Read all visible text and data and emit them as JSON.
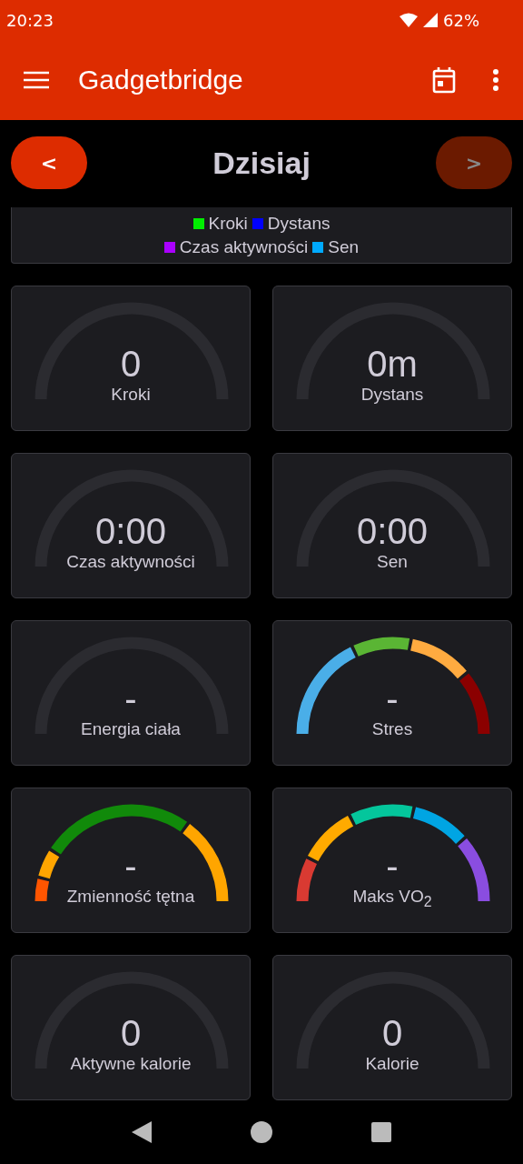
{
  "status_bar": {
    "time": "20:23",
    "battery": "62%"
  },
  "app_bar": {
    "title": "Gadgetbridge"
  },
  "day_nav": {
    "title": "Dzisiaj",
    "prev": {
      "label": "<",
      "disabled": false
    },
    "next": {
      "label": ">",
      "disabled": true
    }
  },
  "legend": [
    {
      "label": "Kroki",
      "color": "#00ee00"
    },
    {
      "label": "Dystans",
      "color": "#0000ff"
    },
    {
      "label": "Czas aktywności",
      "color": "#aa00ff"
    },
    {
      "label": "Sen",
      "color": "#00aaff"
    }
  ],
  "cards": [
    {
      "value": "0",
      "label": "Kroki",
      "kind": "plain"
    },
    {
      "value": "0m",
      "label": "Dystans",
      "kind": "plain"
    },
    {
      "value": "0:00",
      "label": "Czas aktywności",
      "kind": "plain"
    },
    {
      "value": "0:00",
      "label": "Sen",
      "kind": "plain"
    },
    {
      "value": "-",
      "label": "Energia ciała",
      "kind": "plain"
    },
    {
      "value": "-",
      "label": "Stres",
      "kind": "stress",
      "segments": [
        {
          "color": "#4aaee8"
        },
        {
          "color": "#5ab534"
        },
        {
          "color": "#ffab40"
        },
        {
          "color": "#8b0000"
        }
      ]
    },
    {
      "value": "-",
      "label": "Zmienność tętna",
      "kind": "hrv",
      "segments": [
        {
          "color": "#ff5500"
        },
        {
          "color": "#ffa500"
        },
        {
          "color": "#118a0a"
        },
        {
          "color": "#ffa500"
        }
      ]
    },
    {
      "value": "-",
      "label": "Maks VO$_{2}$",
      "kind": "vo2",
      "segments": [
        {
          "color": "#d93a32"
        },
        {
          "color": "#ffaa00"
        },
        {
          "color": "#04c69c"
        },
        {
          "color": "#00a5e3"
        },
        {
          "color": "#8a4de0"
        }
      ]
    },
    {
      "value": "0",
      "label": "Aktywne kalorie",
      "kind": "plain"
    },
    {
      "value": "0",
      "label": "Kalorie",
      "kind": "plain"
    }
  ]
}
